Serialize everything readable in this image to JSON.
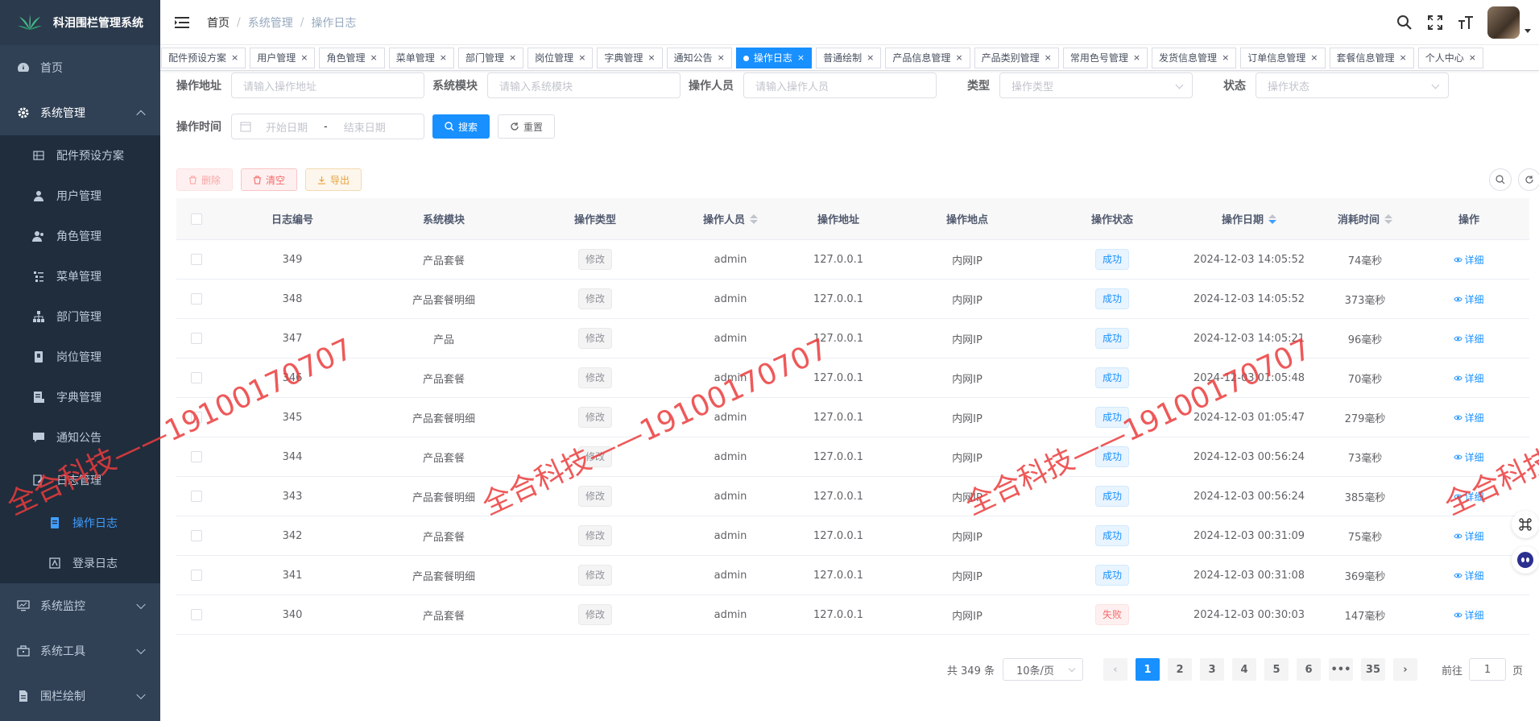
{
  "app": {
    "title": "科泪围栏管理系统"
  },
  "sidebar": {
    "items": [
      {
        "label": "首页"
      },
      {
        "label": "系统管理"
      },
      {
        "label": "配件预设方案"
      },
      {
        "label": "用户管理"
      },
      {
        "label": "角色管理"
      },
      {
        "label": "菜单管理"
      },
      {
        "label": "部门管理"
      },
      {
        "label": "岗位管理"
      },
      {
        "label": "字典管理"
      },
      {
        "label": "通知公告"
      },
      {
        "label": "日志管理"
      },
      {
        "label": "操作日志"
      },
      {
        "label": "登录日志"
      },
      {
        "label": "系统监控"
      },
      {
        "label": "系统工具"
      },
      {
        "label": "围栏绘制"
      }
    ]
  },
  "breadcrumb": {
    "home": "首页",
    "sep": "/",
    "mid": "系统管理",
    "current": "操作日志"
  },
  "tags": [
    "配件预设方案",
    "用户管理",
    "角色管理",
    "菜单管理",
    "部门管理",
    "岗位管理",
    "字典管理",
    "通知公告",
    "操作日志",
    "普通绘制",
    "产品信息管理",
    "产品类别管理",
    "常用色号管理",
    "发货信息管理",
    "订单信息管理",
    "套餐信息管理",
    "个人中心"
  ],
  "filters": {
    "addr_label": "操作地址",
    "addr_ph": "请输入操作地址",
    "module_label": "系统模块",
    "module_ph": "请输入系统模块",
    "user_label": "操作人员",
    "user_ph": "请输入操作人员",
    "type_label": "类型",
    "type_ph": "操作类型",
    "status_label": "状态",
    "status_ph": "操作状态",
    "time_label": "操作时间",
    "start_ph": "开始日期",
    "range_sep": "-",
    "end_ph": "结束日期",
    "search": "搜索",
    "reset": "重置"
  },
  "toolbar": {
    "delete": "删除",
    "clear": "清空",
    "export": "导出"
  },
  "table": {
    "headers": [
      "日志编号",
      "系统模块",
      "操作类型",
      "操作人员",
      "操作地址",
      "操作地点",
      "操作状态",
      "操作日期",
      "消耗时间",
      "操作"
    ],
    "rows": [
      {
        "id": "349",
        "module": "产品套餐",
        "type": "修改",
        "user": "admin",
        "ip": "127.0.0.1",
        "loc": "内网IP",
        "status": "成功",
        "date": "2024-12-03 14:05:52",
        "cost": "74毫秒",
        "action": "详细"
      },
      {
        "id": "348",
        "module": "产品套餐明细",
        "type": "修改",
        "user": "admin",
        "ip": "127.0.0.1",
        "loc": "内网IP",
        "status": "成功",
        "date": "2024-12-03 14:05:52",
        "cost": "373毫秒",
        "action": "详细"
      },
      {
        "id": "347",
        "module": "产品",
        "type": "修改",
        "user": "admin",
        "ip": "127.0.0.1",
        "loc": "内网IP",
        "status": "成功",
        "date": "2024-12-03 14:05:21",
        "cost": "96毫秒",
        "action": "详细"
      },
      {
        "id": "346",
        "module": "产品套餐",
        "type": "修改",
        "user": "admin",
        "ip": "127.0.0.1",
        "loc": "内网IP",
        "status": "成功",
        "date": "2024-12-03 01:05:48",
        "cost": "70毫秒",
        "action": "详细"
      },
      {
        "id": "345",
        "module": "产品套餐明细",
        "type": "修改",
        "user": "admin",
        "ip": "127.0.0.1",
        "loc": "内网IP",
        "status": "成功",
        "date": "2024-12-03 01:05:47",
        "cost": "279毫秒",
        "action": "详细"
      },
      {
        "id": "344",
        "module": "产品套餐",
        "type": "修改",
        "user": "admin",
        "ip": "127.0.0.1",
        "loc": "内网IP",
        "status": "成功",
        "date": "2024-12-03 00:56:24",
        "cost": "73毫秒",
        "action": "详细"
      },
      {
        "id": "343",
        "module": "产品套餐明细",
        "type": "修改",
        "user": "admin",
        "ip": "127.0.0.1",
        "loc": "内网IP",
        "status": "成功",
        "date": "2024-12-03 00:56:24",
        "cost": "385毫秒",
        "action": "详细"
      },
      {
        "id": "342",
        "module": "产品套餐",
        "type": "修改",
        "user": "admin",
        "ip": "127.0.0.1",
        "loc": "内网IP",
        "status": "成功",
        "date": "2024-12-03 00:31:09",
        "cost": "75毫秒",
        "action": "详细"
      },
      {
        "id": "341",
        "module": "产品套餐明细",
        "type": "修改",
        "user": "admin",
        "ip": "127.0.0.1",
        "loc": "内网IP",
        "status": "成功",
        "date": "2024-12-03 00:31:08",
        "cost": "369毫秒",
        "action": "详细"
      },
      {
        "id": "340",
        "module": "产品套餐",
        "type": "修改",
        "user": "admin",
        "ip": "127.0.0.1",
        "loc": "内网IP",
        "status": "失败",
        "date": "2024-12-03 00:30:03",
        "cost": "147毫秒",
        "action": "详细"
      }
    ]
  },
  "pagination": {
    "total": "共 349 条",
    "size": "10条/页",
    "pages": [
      "1",
      "2",
      "3",
      "4",
      "5",
      "6",
      "•••",
      "35"
    ],
    "goto": "前往",
    "goto_value": "1",
    "page_unit": "页"
  },
  "watermark": "全合科技——19100170707",
  "colors": {
    "sidebar": "#304156",
    "primary": "#1890ff",
    "danger": "#f56c6c",
    "warning": "#e6a23c"
  }
}
